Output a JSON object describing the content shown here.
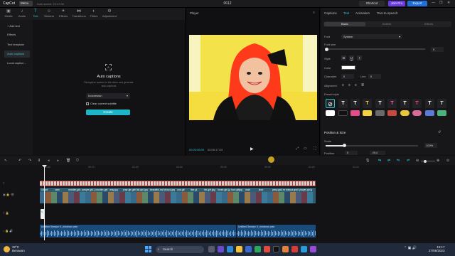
{
  "app": {
    "logo": "CapCut",
    "menu_label": "Menu",
    "autosave": "Auto saved: 15:17:08",
    "project_title": "0612",
    "shortcut_label": "Shortcut",
    "join_pro_label": "Join Pro",
    "export_label": "Export",
    "window_controls": [
      "—",
      "❐",
      "✕"
    ]
  },
  "media_tabs": [
    {
      "label": "Media",
      "icon": "media-icon"
    },
    {
      "label": "Audio",
      "icon": "audio-icon"
    },
    {
      "label": "Text",
      "icon": "text-icon",
      "active": true
    },
    {
      "label": "Stickers",
      "icon": "sticker-icon"
    },
    {
      "label": "Effects",
      "icon": "effects-icon"
    },
    {
      "label": "Transitions",
      "icon": "transition-icon"
    },
    {
      "label": "Filters",
      "icon": "filter-icon"
    },
    {
      "label": "Adjustment",
      "icon": "adjustment-icon"
    }
  ],
  "sidebar": {
    "items": [
      {
        "label": "+ Add text"
      },
      {
        "label": "Effects"
      },
      {
        "label": "Text template"
      },
      {
        "label": "Auto captions",
        "active": true
      },
      {
        "label": "Local caption..."
      }
    ]
  },
  "auto_captions": {
    "title": "Auto captions",
    "description": "Recognize speech in the video and generate auto captions",
    "language": "Indonesian",
    "clear_subtitle_label": "Clear current subtitle",
    "create_label": "Create"
  },
  "player": {
    "title": "Player",
    "current_time": "00:00:06:09",
    "total_time": "00:06:17:03"
  },
  "right_panel": {
    "tabs": [
      "Captions",
      "Text",
      "Animation",
      "Text-to-speech"
    ],
    "active_tab": "Text",
    "subtabs": [
      "Basic",
      "Bubble",
      "Effects"
    ],
    "labels": {
      "font": "Font",
      "font_size": "Font size",
      "style": "Style",
      "color": "Color",
      "character": "Character",
      "line": "Line",
      "alignment": "Alignment",
      "preset_style": "Preset style",
      "position_size": "Position & Size",
      "scale": "Scale",
      "position": "Position"
    },
    "font_value": "System",
    "font_size_value": "5",
    "style_buttons": [
      "B",
      "U",
      "I"
    ],
    "color_value": "#ffffff",
    "character_value": "0",
    "line_value": "0",
    "scale_value": "100%",
    "scale_fraction": 0.2,
    "position_x": "0",
    "position_y": "-914",
    "font_size_fraction": 0.0
  },
  "timeline": {
    "ruler_labels": [
      "00:00",
      "00:10",
      "01:20",
      "00:30",
      "00:40",
      "00:50",
      "01:00",
      "01:10"
    ],
    "video_clip_labels": [
      "16 prt",
      "cam",
      "muslim-gilr.jpg",
      "prayer-girl.jpg",
      "muslim-girl.jpg",
      "pray.jpg",
      "pray-gir-girls.jpg",
      "fall-girl.jpg",
      "beautiful.mp4",
      "Mecca.jpg",
      "cue-gif",
      "ilse-gi",
      "bb-girl.jpg",
      "heart-girl.jpg",
      "tocr-gifjpg",
      "bush",
      "shot",
      "pray-gw4.mp4",
      "mecca-gw4.mp4",
      "prayer-girl.jpg"
    ],
    "audio_clips": [
      {
        "label": "Untitled Session 9_mixdown.wav"
      },
      {
        "label": "Untitled Session 9_mixdown.wav"
      }
    ]
  },
  "taskbar": {
    "temperature": "32°C",
    "weather": "Berawan",
    "search_placeholder": "Search",
    "time": "15:17",
    "date": "27/06/2023"
  }
}
